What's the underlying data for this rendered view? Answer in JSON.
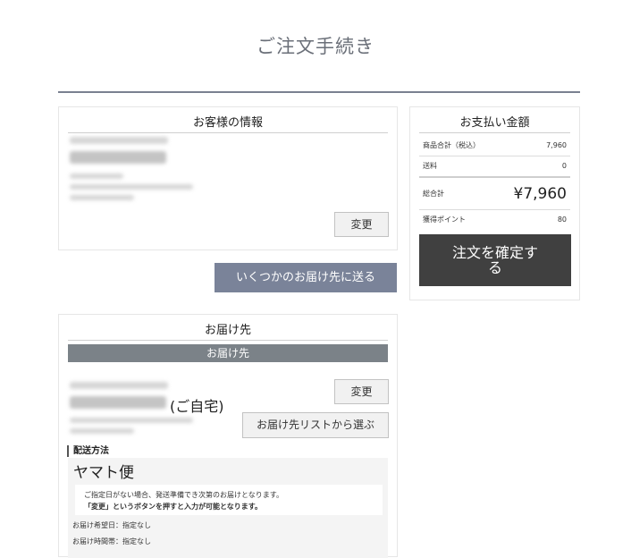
{
  "page": {
    "title": "ご注文手続き"
  },
  "customer": {
    "heading": "お客様の情報",
    "change_label": "変更"
  },
  "multi_ship_label": "いくつかのお届け先に送る",
  "payment": {
    "heading": "お支払い金額",
    "rows": [
      {
        "label": "商品合計（税込）",
        "value": "7,960"
      },
      {
        "label": "送料",
        "value": "0"
      },
      {
        "label": "総合計",
        "value": "¥7,960"
      },
      {
        "label": "獲得ポイント",
        "value": "80"
      }
    ],
    "confirm_label": "注文を確定する"
  },
  "delivery": {
    "heading": "お届け先",
    "subheading": "お届け先",
    "home_suffix": "(ご自宅)",
    "change_label": "変更",
    "choose_label": "お届け先リストから選ぶ",
    "method_heading": "配送方法",
    "carrier": "ヤマト便",
    "notice_line1": "ご指定日がない場合、発送準備でき次第のお届けとなります。",
    "notice_line2": "「変更」というボタンを押すと入力が可能となります。",
    "date_label": "お届け希望日：",
    "date_value": "指定なし",
    "time_label": "お届け時間帯：",
    "time_value": "指定なし"
  }
}
